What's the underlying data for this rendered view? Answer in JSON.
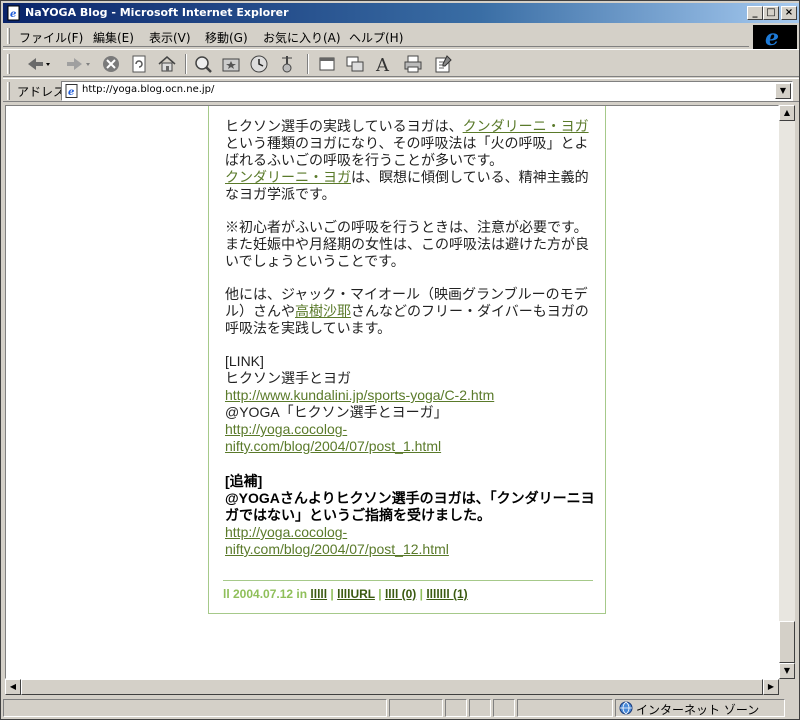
{
  "window": {
    "title": "NaYOGA Blog - Microsoft Internet Explorer",
    "min_glyph": "_",
    "max_glyph": "□",
    "close_glyph": "×"
  },
  "menu": {
    "items": [
      {
        "label": "ファイル(F)"
      },
      {
        "label": "編集(E)"
      },
      {
        "label": "表示(V)"
      },
      {
        "label": "移動(G)"
      },
      {
        "label": "お気に入り(A)"
      },
      {
        "label": "ヘルプ(H)"
      }
    ]
  },
  "toolbar": {
    "icons": [
      "back-icon",
      "forward-icon",
      "stop-icon",
      "refresh-icon",
      "home-icon",
      "search-icon",
      "favorites-icon",
      "history-icon",
      "channels-icon",
      "fullscreen-icon",
      "mail-icon",
      "font-icon",
      "print-icon",
      "edit-icon"
    ]
  },
  "address": {
    "label": "アドレス",
    "url": "http://yoga.blog.ocn.ne.jp/"
  },
  "post": {
    "p1_a": "ヒクソン選手の実践しているヨガは、",
    "p1_link": "クンダリーニ・ヨガ",
    "p1_b": "という種類のヨガになり、その呼吸法は「火の呼吸」とよばれるふいごの呼吸を行うことが多いです。",
    "p1_link2": "クンダリーニ・ヨガ",
    "p1_c": "は、瞑想に傾倒している、精神主義的なヨガ学派です。",
    "p2": "※初心者がふいごの呼吸を行うときは、注意が必要です。また妊娠中や月経期の女性は、この呼吸法は避けた方が良いでしょうということです。",
    "p3_a": "他には、ジャック・マイオール（映画グランブルーのモデル）さんや",
    "p3_link": "高樹沙耶",
    "p3_b": "さんなどのフリー・ダイバーもヨガの呼吸法を実践しています。",
    "link_header": "[LINK]",
    "link1_title": "ヒクソン選手とヨガ",
    "link1_url": "http://www.kundalini.jp/sports-yoga/C-2.htm",
    "link2_title": "@YOGA「ヒクソン選手とヨーガ」",
    "link2_url_a": "http://yoga.cocolog-",
    "link2_url_b": "nifty.com/blog/2004/07/post_1.html",
    "addendum_title": "[追補]",
    "addendum_text": "@YOGAさんよりヒクソン選手のヨガは、「クンダリーニヨガではない」というご指摘を受けました。",
    "link3_url_a": "http://yoga.cocolog-",
    "link3_url_b": "nifty.com/blog/2004/07/post_12.html"
  },
  "footer": {
    "date_text": "ll 2004.07.12 in",
    "category": "lllll",
    "sep1": "|",
    "permalink": "llllURL",
    "sep2": "|",
    "comments": "llll (0)",
    "sep3": "|",
    "trackbacks": "lllllll (1)"
  },
  "status": {
    "zone_label": "インターネット ゾーン"
  },
  "colors": {
    "title_gradient_start": "#0a246a",
    "link_green": "#5a7a2a",
    "footer_green": "#8fbf5a",
    "border_green": "#a6c98a"
  }
}
